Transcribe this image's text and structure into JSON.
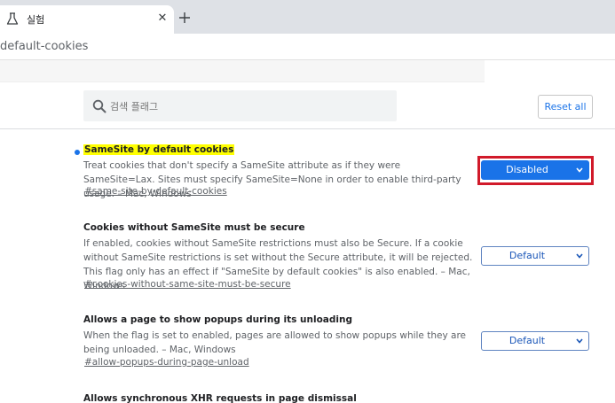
{
  "tab": {
    "title": "실험",
    "close_glyph": "✕",
    "new_tab_glyph": "+"
  },
  "address": {
    "text": "default-cookies"
  },
  "search": {
    "placeholder": "검색 플래그"
  },
  "header": {
    "reset_label": "Reset all"
  },
  "experiments": [
    {
      "title": "SameSite by default cookies",
      "description": "Treat cookies that don't specify a SameSite attribute as if they were SameSite=Lax. Sites must specify SameSite=None in order to enable third-party usage. – Mac, Windows",
      "link": "#same-site-by-default-cookies",
      "value": "Disabled",
      "modified": true
    },
    {
      "title": "Cookies without SameSite must be secure",
      "description": "If enabled, cookies without SameSite restrictions must also be Secure. If a cookie without SameSite restrictions is set without the Secure attribute, it will be rejected. This flag only has an effect if \"SameSite by default cookies\" is also enabled. – Mac, Windows",
      "link": "#cookies-without-same-site-must-be-secure",
      "value": "Default",
      "modified": false
    },
    {
      "title": "Allows a page to show popups during its unloading",
      "description": "When the flag is set to enabled, pages are allowed to show popups while they are being unloaded. – Mac, Windows",
      "link": "#allow-popups-during-page-unload",
      "value": "Default",
      "modified": false
    },
    {
      "title": "Allows synchronous XHR requests in page dismissal"
    }
  ],
  "colors": {
    "accent": "#1a73e8",
    "highlight": "#ffff00",
    "focus_frame": "#d11a2a"
  }
}
